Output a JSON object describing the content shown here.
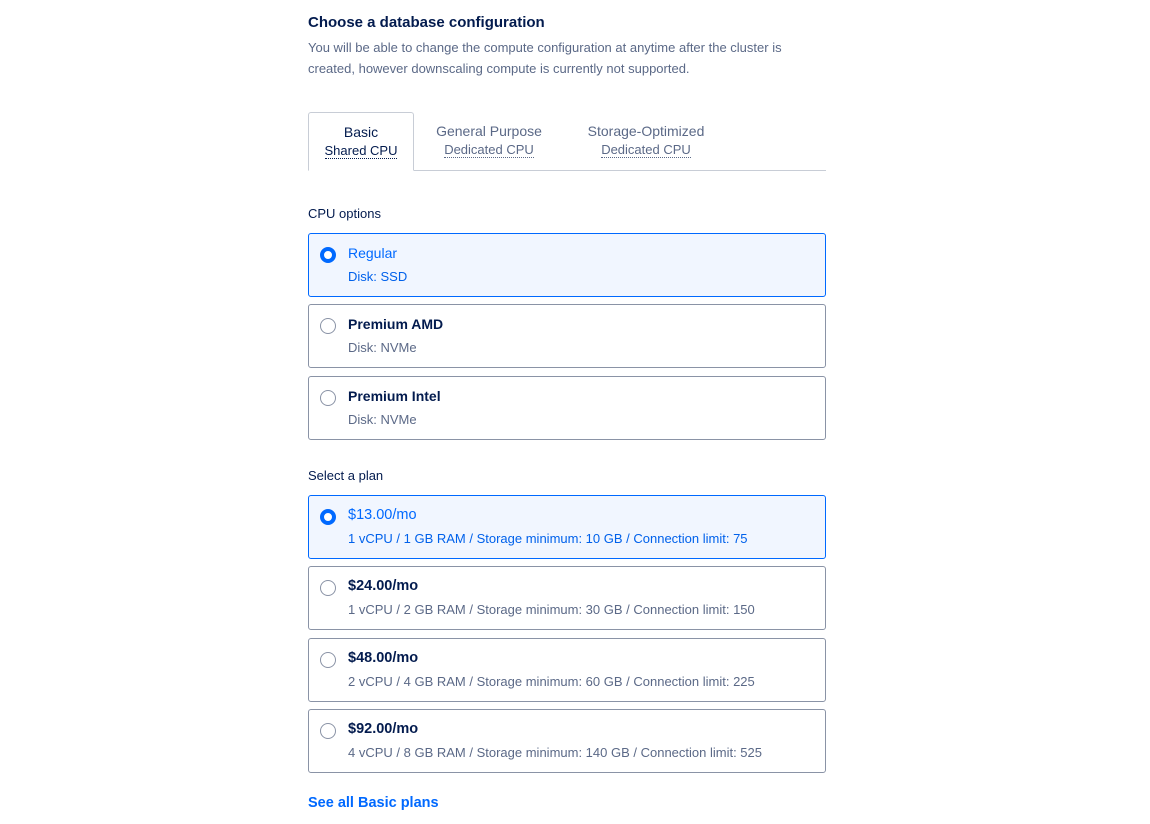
{
  "header": {
    "title": "Choose a database configuration",
    "description": "You will be able to change the compute configuration at anytime after the cluster is created, however downscaling compute is currently not supported."
  },
  "tabs": [
    {
      "label": "Basic",
      "sublabel": "Shared CPU",
      "active": true
    },
    {
      "label": "General Purpose",
      "sublabel": "Dedicated CPU",
      "active": false
    },
    {
      "label": "Storage-Optimized",
      "sublabel": "Dedicated CPU",
      "active": false
    }
  ],
  "cpu_options": {
    "label": "CPU options",
    "items": [
      {
        "title": "Regular",
        "subtitle": "Disk: SSD",
        "selected": true
      },
      {
        "title": "Premium AMD",
        "subtitle": "Disk: NVMe",
        "selected": false
      },
      {
        "title": "Premium Intel",
        "subtitle": "Disk: NVMe",
        "selected": false
      }
    ]
  },
  "plans": {
    "label": "Select a plan",
    "items": [
      {
        "price": "$13.00/mo",
        "specs": "1 vCPU / 1 GB RAM / Storage minimum: 10 GB / Connection limit: 75",
        "selected": true
      },
      {
        "price": "$24.00/mo",
        "specs": "1 vCPU / 2 GB RAM / Storage minimum: 30 GB / Connection limit: 150",
        "selected": false
      },
      {
        "price": "$48.00/mo",
        "specs": "2 vCPU / 4 GB RAM / Storage minimum: 60 GB / Connection limit: 225",
        "selected": false
      },
      {
        "price": "$92.00/mo",
        "specs": "4 vCPU / 8 GB RAM / Storage minimum: 140 GB / Connection limit: 525",
        "selected": false
      }
    ],
    "see_all_label": "See all Basic plans"
  },
  "colors": {
    "accent": "#0069ff",
    "text": "#031b4e",
    "muted": "#5b6987",
    "selected_bg": "#f1f6ff"
  }
}
